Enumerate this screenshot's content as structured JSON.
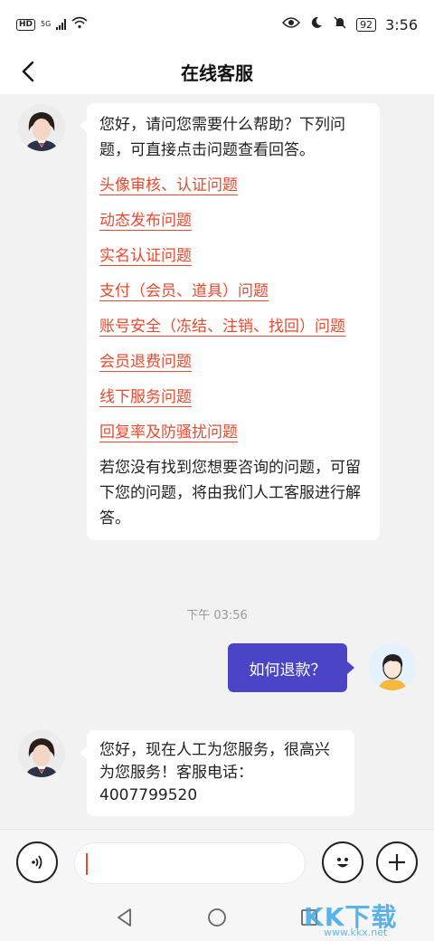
{
  "status_bar": {
    "hd": "HD",
    "network": "5G",
    "battery": "92",
    "time": "3:56"
  },
  "header": {
    "title": "在线客服"
  },
  "chat": {
    "agent_message_1": {
      "intro": "您好，请问您需要什么帮助？下列问题，可直接点击问题查看回答。",
      "links": [
        "头像审核、认证问题",
        "动态发布问题",
        "实名认证问题",
        "支付（会员、道具）问题",
        "账号安全（冻结、注销、找回）问题",
        "会员退费问题",
        "线下服务问题",
        "回复率及防骚扰问题"
      ],
      "outro": "若您没有找到您想要咨询的问题，可留下您的问题，将由我们人工客服进行解答。"
    },
    "timestamp": "下午 03:56",
    "user_message": "如何退款？",
    "agent_message_2": "您好，现在人工为您服务，很高兴为您服务！客服电话：4007799520"
  },
  "input": {
    "placeholder": ""
  },
  "watermark": {
    "brand": "KK下载",
    "url": "www.kkx.net"
  },
  "colors": {
    "link": "#e8492f",
    "user_bubble": "#4a45c6",
    "background": "#f2f2f2"
  }
}
